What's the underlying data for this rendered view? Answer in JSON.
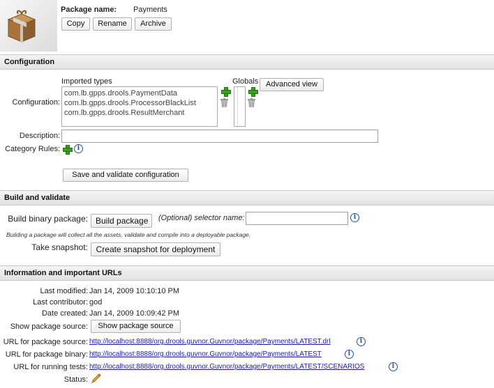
{
  "package": {
    "name_label": "Package name:",
    "name_value": "Payments",
    "copy_label": "Copy",
    "rename_label": "Rename",
    "archive_label": "Archive"
  },
  "configuration": {
    "section_title": "Configuration",
    "imported_types_label": "Imported types",
    "globals_label": "Globals",
    "advanced_view_label": "Advanced view",
    "config_label": "Configuration:",
    "imported_types": [
      "com.lb.gpps.drools.PaymentData",
      "com.lb.gpps.drools.ProcessorBlackList",
      "com.lb.gpps.drools.ResultMerchant"
    ],
    "description_label": "Description:",
    "description_value": "",
    "category_rules_label": "Category Rules:",
    "save_label": "Save and validate configuration"
  },
  "build": {
    "section_title": "Build and validate",
    "binary_label": "Build binary package:",
    "build_button_label": "Build package",
    "selector_label": "(Optional) selector name:",
    "selector_value": "",
    "hint": "Building a package will collect all the assets, validate and compile into a deployable package.",
    "snapshot_label": "Take snapshot:",
    "snapshot_button_label": "Create snapshot for deployment"
  },
  "info": {
    "section_title": "Information and important URLs",
    "last_modified_label": "Last modified:",
    "last_modified_value": "Jan 14, 2009 10:10:10 PM",
    "last_contributor_label": "Last contributor:",
    "last_contributor_value": "god",
    "date_created_label": "Date created:",
    "date_created_value": "Jan 14, 2009 10:09:42 PM",
    "show_source_label": "Show package source:",
    "show_source_button_label": "Show package source",
    "url_source_label": "URL for package source:",
    "url_source_value": "http://localhost:8888/org.drools.guvnor.Guvnor/package/Payments/LATEST.drl",
    "url_binary_label": "URL for package binary:",
    "url_binary_value": "http://localhost:8888/org.drools.guvnor.Guvnor/package/Payments/LATEST",
    "url_tests_label": "URL for running tests:",
    "url_tests_value": "http://localhost:8888/org.drools.guvnor.Guvnor/package/Payments/LATEST/SCENARIOS",
    "status_label": "Status:"
  },
  "icons": {
    "package": "package-box-icon",
    "add": "add-icon",
    "delete": "trash-icon",
    "info": "info-icon",
    "edit": "pencil-icon"
  }
}
